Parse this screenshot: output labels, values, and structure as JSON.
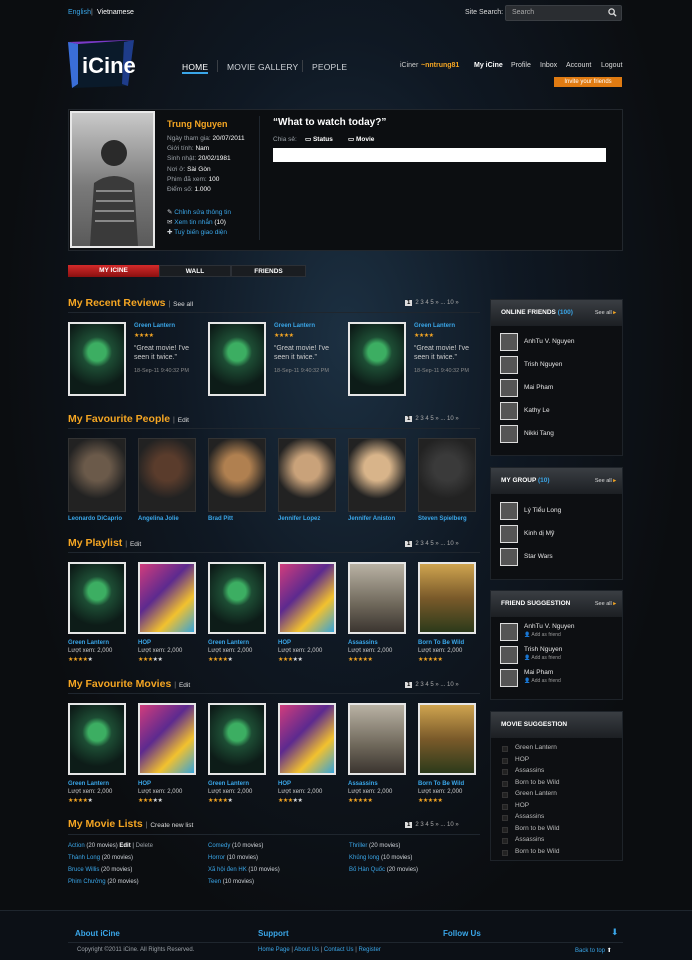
{
  "topbar": {
    "lang_en": "English",
    "lang_vi": "Vietnamese",
    "search_label": "Site Search:",
    "search_placeholder": "Search"
  },
  "logo": {
    "text": "iCine"
  },
  "nav": {
    "home": "HOME",
    "gallery": "MOVIE GALLERY",
    "people": "PEOPLE"
  },
  "usernav": {
    "prefix": "iCiner",
    "user": "~nntrung81",
    "myicine": "My iCine",
    "profile": "Profile",
    "inbox": "Inbox",
    "account": "Account",
    "logout": "Logout",
    "invite": "Invite your friends"
  },
  "profile": {
    "name": "Trung Nguyen",
    "join_label": "Ngày tham gia:",
    "join": "20/07/2011",
    "gender_label": "Giới tính:",
    "gender": "Nam",
    "birth_label": "Sinh nhật:",
    "birth": "20/02/1981",
    "loc_label": "Nơi ở:",
    "loc": "Sài Gòn",
    "seen_label": "Phim đã xem:",
    "seen": "100",
    "score_label": "Điểm số:",
    "score": "1.000",
    "edit": "Chỉnh sửa thông tin",
    "messages": "Xem tin nhắn",
    "messages_count": "(10)",
    "theme": "Tuỳ biến giao diện"
  },
  "status": {
    "question": "“What to watch today?”",
    "share_label": "Chia sẻ:",
    "opt_status": "Status",
    "opt_movie": "Movie"
  },
  "tabs": [
    "MY ICINE",
    "WALL",
    "FRIENDS"
  ],
  "pager": {
    "current": "1",
    "rest": "2  3  4  5  »   ...   10 »"
  },
  "reviews": {
    "title": "My Recent Reviews",
    "link": "See all",
    "items": [
      {
        "movie": "Green Lantern",
        "stars": "★★★★",
        "text": "“Great movie! I've seen it twice.”",
        "date": "18-Sep-11 9:40:32 PM"
      },
      {
        "movie": "Green Lantern",
        "stars": "★★★★",
        "text": "“Great movie! I've seen it twice.”",
        "date": "18-Sep-11 9:40:32 PM"
      },
      {
        "movie": "Green Lantern",
        "stars": "★★★★",
        "text": "“Great movie! I've seen it twice.”",
        "date": "18-Sep-11 9:40:32 PM"
      }
    ]
  },
  "people": {
    "title": "My Favourite People",
    "link": "Edit",
    "items": [
      "Leonardo DiCaprio",
      "Angelina Jolie",
      "Brad Pitt",
      "Jennifer Lopez",
      "Jennifer Aniston",
      "Steven Spielberg"
    ]
  },
  "playlist": {
    "title": "My Playlist",
    "link": "Edit",
    "items": [
      {
        "name": "Green Lantern",
        "views": "Lượt xem: 2,000"
      },
      {
        "name": "HOP",
        "views": "Lượt xem: 2,000"
      },
      {
        "name": "Green Lantern",
        "views": "Lượt xem: 2,000"
      },
      {
        "name": "HOP",
        "views": "Lượt xem: 2,000"
      },
      {
        "name": "Assassins",
        "views": "Lượt xem: 2,000"
      },
      {
        "name": "Born To Be Wild",
        "views": "Lượt xem: 2,000"
      }
    ]
  },
  "favmovies": {
    "title": "My Favourite Movies",
    "link": "Edit",
    "items": [
      {
        "name": "Green Lantern",
        "views": "Lượt xem: 2,000"
      },
      {
        "name": "HOP",
        "views": "Lượt xem: 2,000"
      },
      {
        "name": "Green Lantern",
        "views": "Lượt xem: 2,000"
      },
      {
        "name": "HOP",
        "views": "Lượt xem: 2,000"
      },
      {
        "name": "Assassins",
        "views": "Lượt xem: 2,000"
      },
      {
        "name": "Born To Be Wild",
        "views": "Lượt xem: 2,000"
      }
    ]
  },
  "lists": {
    "title": "My Movie Lists",
    "link": "Create new list",
    "col1": [
      {
        "n": "Action",
        "c": "(20 movies)"
      },
      {
        "n": "Thành Long",
        "c": "(20 movies)"
      },
      {
        "n": "Bruce Willis",
        "c": "(20 movies)"
      },
      {
        "n": "Phim Chưởng",
        "c": "(20 movies)"
      }
    ],
    "col2": [
      {
        "n": "Comedy",
        "c": "(10 movies)"
      },
      {
        "n": "Horror",
        "c": "(10 movies)"
      },
      {
        "n": "Xã hội đen HK",
        "c": "(10 movies)"
      },
      {
        "n": "Teen",
        "c": "(10 movies)"
      }
    ],
    "col3": [
      {
        "n": "Thriller",
        "c": "(20 movies)"
      },
      {
        "n": "Khủng long",
        "c": "(10 movies)"
      },
      {
        "n": "Bố Hàn Quốc",
        "c": "(20 movies)"
      }
    ],
    "edit": "Edit",
    "delete": "Delete"
  },
  "sidebar": {
    "online": {
      "title": "ONLINE FRIENDS",
      "count": "(100)",
      "see": "See all",
      "items": [
        "AnhTu V. Nguyen",
        "Trish Nguyen",
        "Mai Pham",
        "Kathy Le",
        "Nikki Tang"
      ]
    },
    "group": {
      "title": "MY GROUP",
      "count": "(10)",
      "see": "See all",
      "items": [
        "Lý Tiểu Long",
        "Kinh dị Mỹ",
        "Star Wars"
      ]
    },
    "suggest": {
      "title": "FRIEND SUGGESTION",
      "see": "See all",
      "add": "Add as friend",
      "items": [
        "AnhTu V. Nguyen",
        "Trish Nguyen",
        "Mai Pham"
      ]
    },
    "movies": {
      "title": "MOVIE SUGGESTION",
      "items": [
        "Green Lantern",
        "HOP",
        "Assassins",
        "Born to be Wild",
        "Green Lantern",
        "HOP",
        "Assassins",
        "Born to be Wild",
        "Assassins",
        "Born to be Wild"
      ]
    }
  },
  "footer": {
    "about": "About iCine",
    "support": "Support",
    "follow": "Follow Us",
    "copyright": "Copyright ©2011 iCine. All Rights Reserved.",
    "home": "Home Page",
    "aboutus": "About Us",
    "contact": "Contact Us",
    "register": "Register",
    "back": "Back to top"
  }
}
